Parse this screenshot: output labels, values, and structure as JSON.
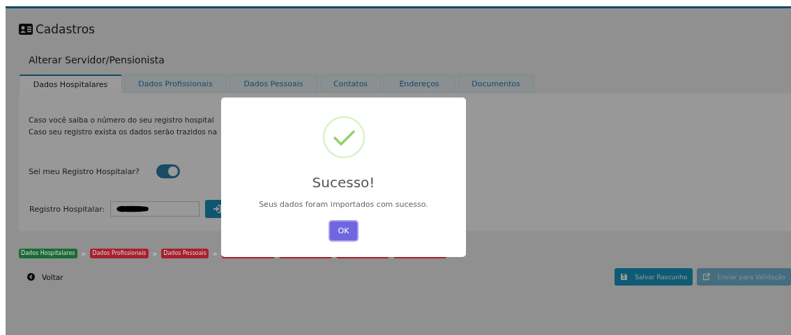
{
  "header": {
    "title": "Cadastros"
  },
  "form": {
    "title": "Alterar Servidor/Pensionista",
    "tabs": [
      {
        "label": "Dados Hospitalares",
        "selected": true
      },
      {
        "label": "Dados Profissionais",
        "selected": false
      },
      {
        "label": "Dados Pessoais",
        "selected": false
      },
      {
        "label": "Contatos",
        "selected": false
      },
      {
        "label": "Endereços",
        "selected": false
      },
      {
        "label": "Documentos",
        "selected": false
      }
    ],
    "intro": [
      "Caso você saiba o número do seu registro hospital",
      "Caso seu registro exista os dados serão trazidos na"
    ],
    "toggle": {
      "label": "Sei meu Registro Hospitalar?",
      "on": true
    },
    "registro": {
      "label": "Registro Hospitalar:",
      "redacted": true
    }
  },
  "breadcrumb": {
    "separator": "»",
    "steps": [
      {
        "label": "Dados Hospitalares",
        "color": "#1a6b35"
      },
      {
        "label": "Dados Profissionais",
        "color": "#a8202d"
      },
      {
        "label": "Dados Pessoais",
        "color": "#a8202d"
      },
      {
        "color": "#a8202d"
      },
      {
        "color": "#a8202d"
      },
      {
        "color": "#a8202d"
      },
      {
        "color": "#a8202d"
      }
    ]
  },
  "back_link": "Voltar",
  "actions": [
    {
      "label": "Salvar Rascunho",
      "kind": "save",
      "disabled": false
    },
    {
      "label": "Enviar para Validação",
      "kind": "send",
      "disabled": true
    }
  ],
  "dialog": {
    "title": "Sucesso!",
    "message": "Seus dados foram importados com sucesso.",
    "button": "OK"
  }
}
